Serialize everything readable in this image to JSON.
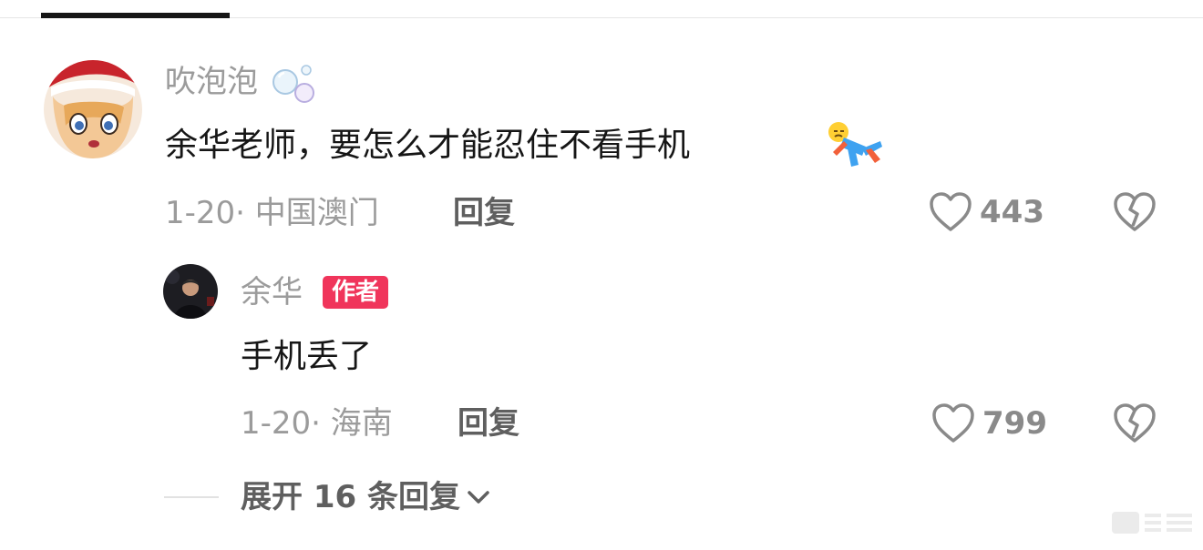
{
  "comment": {
    "username": "吹泡泡",
    "text": "余华老师，要怎么才能忍住不看手机",
    "meta": "1-20· 中国澳门",
    "reply_label": "回复",
    "like_count": "443"
  },
  "reply": {
    "username": "余华",
    "badge": "作者",
    "text": "手机丢了",
    "meta": "1-20· 海南",
    "reply_label": "回复",
    "like_count": "799"
  },
  "expand_label": "展开 16 条回复"
}
